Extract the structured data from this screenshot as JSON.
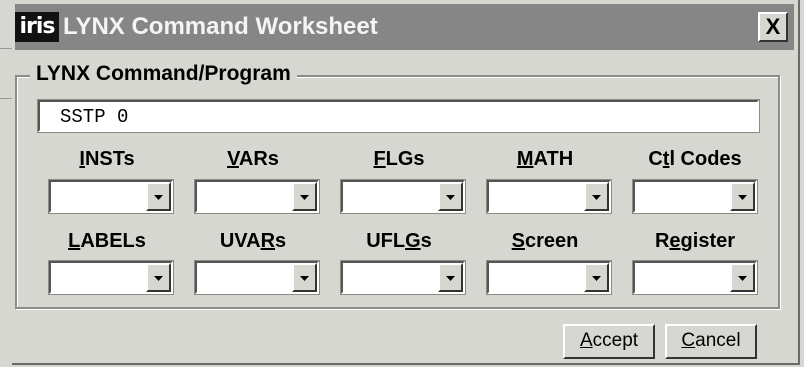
{
  "window": {
    "logo_text": "iris",
    "title": "LYNX Command Worksheet",
    "close_label": "X"
  },
  "group": {
    "title": "LYNX Command/Program",
    "command_value": "SSTP 0"
  },
  "row1": [
    {
      "pre": "",
      "ul": "I",
      "post": "NSTs"
    },
    {
      "pre": "",
      "ul": "V",
      "post": "ARs"
    },
    {
      "pre": "",
      "ul": "F",
      "post": "LGs"
    },
    {
      "pre": "",
      "ul": "M",
      "post": "ATH"
    },
    {
      "pre": "C",
      "ul": "t",
      "post": "l Codes"
    }
  ],
  "row2": [
    {
      "pre": "",
      "ul": "L",
      "post": "ABELs"
    },
    {
      "pre": "UVA",
      "ul": "R",
      "post": "s"
    },
    {
      "pre": "UFL",
      "ul": "G",
      "post": "s"
    },
    {
      "pre": "",
      "ul": "S",
      "post": "creen"
    },
    {
      "pre": "R",
      "ul": "e",
      "post": "gister"
    }
  ],
  "buttons": {
    "accept": {
      "pre": "",
      "ul": "A",
      "post": "ccept"
    },
    "cancel": {
      "pre": "",
      "ul": "C",
      "post": "ancel"
    }
  }
}
